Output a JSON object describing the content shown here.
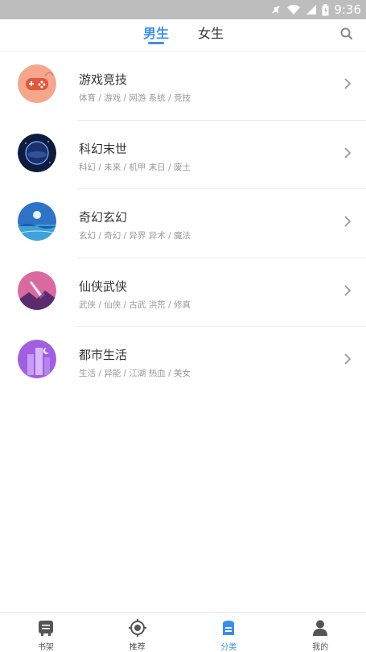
{
  "status_bar": {
    "time": "9:36"
  },
  "header": {
    "tabs": [
      {
        "label": "男生",
        "active": true
      },
      {
        "label": "女生",
        "active": false
      }
    ],
    "accent_color": "#3b8ded"
  },
  "categories": [
    {
      "title": "游戏竞技",
      "tags": "体育 / 游戏 / 网游  系统 / 竞技",
      "icon": "gamepad-icon"
    },
    {
      "title": "科幻末世",
      "tags": "科幻 / 未来 / 机甲  末日 / 废土",
      "icon": "planet-icon"
    },
    {
      "title": "奇幻玄幻",
      "tags": "玄幻 / 奇幻 / 异界  异术 / 魔法",
      "icon": "fantasy-moon-icon"
    },
    {
      "title": "仙侠武侠",
      "tags": "武侠 / 仙侠 / 古武  洪荒 / 修真",
      "icon": "sword-icon"
    },
    {
      "title": "都市生活",
      "tags": "生活 / 异能 / 江湖  热血 / 美女",
      "icon": "city-icon"
    }
  ],
  "bottom_nav": [
    {
      "label": "书架",
      "icon": "bookshelf-icon",
      "active": false
    },
    {
      "label": "推荐",
      "icon": "recommend-icon",
      "active": false
    },
    {
      "label": "分类",
      "icon": "category-icon",
      "active": true
    },
    {
      "label": "我的",
      "icon": "profile-icon",
      "active": false
    }
  ]
}
